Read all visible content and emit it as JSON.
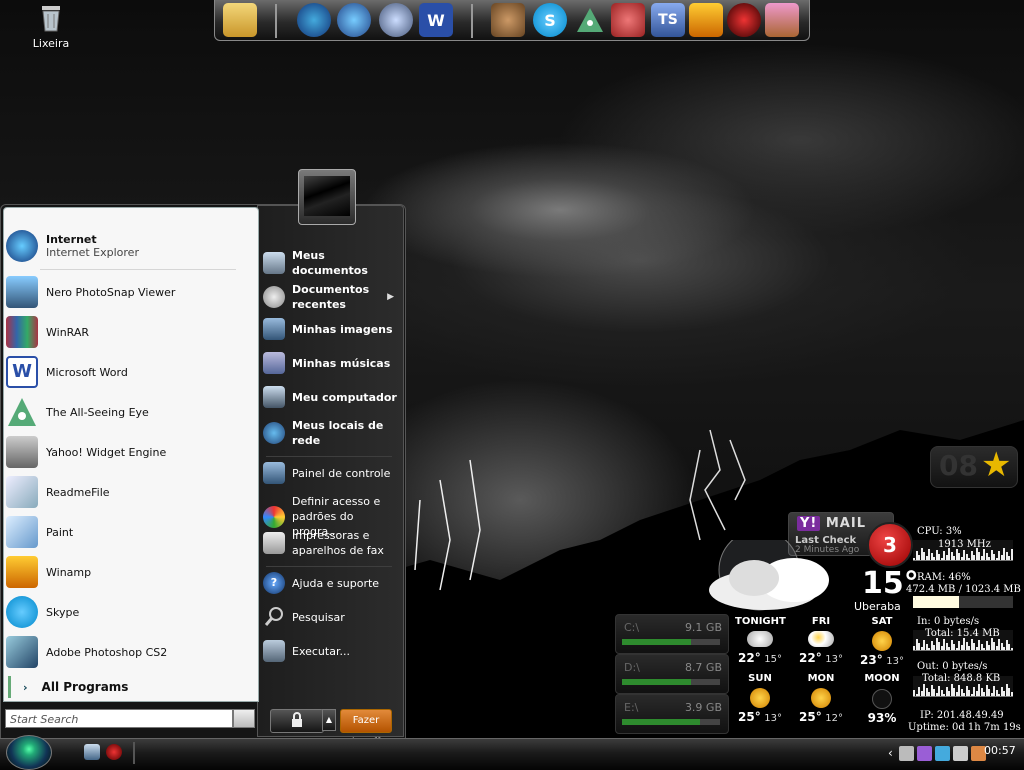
{
  "desktop": {
    "recycle_bin_label": "Lixeira"
  },
  "dock": {
    "icons": [
      "folder-icon",
      "internet-explorer-icon",
      "messenger-icon",
      "web-browser-icon",
      "word-icon",
      "emule-icon",
      "skype-icon",
      "all-seeing-eye-icon",
      "game-icon",
      "teamspeak-icon",
      "winamp-icon",
      "media-player-icon",
      "anime-girl-icon"
    ],
    "teamspeak_label": "TS"
  },
  "start_menu": {
    "pinned": [
      {
        "title": "Internet",
        "subtitle": "Internet Explorer"
      }
    ],
    "recent": [
      "Nero PhotoSnap Viewer",
      "WinRAR",
      "Microsoft Word",
      "The All-Seeing Eye",
      "Yahoo! Widget Engine",
      "ReadmeFile",
      "Paint",
      "Winamp",
      "Skype",
      "Adobe Photoshop CS2"
    ],
    "all_programs": "All Programs",
    "search_placeholder": "Start Search",
    "right": {
      "meus_documentos": "Meus documentos",
      "documentos_recentes": "Documentos recentes",
      "minhas_imagens": "Minhas imagens",
      "minhas_musicas": "Minhas músicas",
      "meu_computador": "Meu computador",
      "meus_locais": "Meus locais de rede",
      "painel": "Painel de controle",
      "definir": "Definir acesso e padrões do progra...",
      "impressoras": "Impressoras e aparelhos de fax",
      "ajuda": "Ajuda e suporte",
      "pesquisar": "Pesquisar",
      "executar": "Executar..."
    },
    "power_label": "Fazer logoff"
  },
  "drives": [
    {
      "label": "C:\\",
      "size": "9.1 GB",
      "used_fraction": 0.7
    },
    {
      "label": "D:\\",
      "size": "8.7 GB",
      "used_fraction": 0.7
    },
    {
      "label": "E:\\",
      "size": "3.9 GB",
      "used_fraction": 0.8
    }
  ],
  "yahoo_mail": {
    "title": "MAIL",
    "last_check": "Last Check",
    "ago": "2 Minutes Ago",
    "count": "3"
  },
  "weather": {
    "temp": "15°",
    "city": "Uberaba",
    "forecast": [
      {
        "day": "TONIGHT",
        "hi": "22°",
        "lo": "15°",
        "icon": "cloud-icon"
      },
      {
        "day": "FRI",
        "hi": "22°",
        "lo": "13°",
        "icon": "cloud-sun-icon"
      },
      {
        "day": "SAT",
        "hi": "23°",
        "lo": "13°",
        "icon": "sun-icon"
      },
      {
        "day": "SUN",
        "hi": "25°",
        "lo": "13°",
        "icon": "sun-icon"
      },
      {
        "day": "MON",
        "hi": "25°",
        "lo": "12°",
        "icon": "sun-icon"
      },
      {
        "day": "MOON",
        "pct": "93%",
        "icon": "moon-icon"
      }
    ]
  },
  "system": {
    "cpu": "CPU: 3%",
    "cpu_mhz": "1913 MHz",
    "ram": "RAM: 46%",
    "ram_detail": "472.4 MB / 1023.4 MB",
    "ram_fraction": 0.46,
    "net_in": "In: 0 bytes/s",
    "net_in_total": "Total: 15.4 MB",
    "net_out": "Out: 0 bytes/s",
    "net_out_total": "Total: 848.8 KB",
    "ip": "IP: 201.48.49.49",
    "uptime": "Uptime: 0d 1h 7m 19s"
  },
  "clock_widget": {
    "digits": "08"
  },
  "taskbar": {
    "clock": "00:57"
  }
}
